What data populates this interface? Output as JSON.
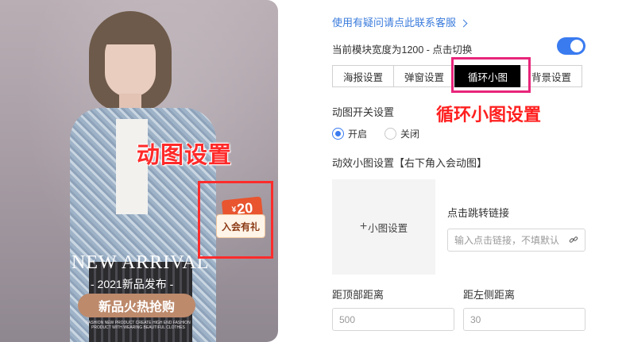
{
  "poster": {
    "gif_heading": "动图设置",
    "coupon": {
      "currency": "¥",
      "amount": "20",
      "caption": "入会有礼"
    },
    "headline": "NEW ARRIVAL",
    "subline": "- 2021新品发布 -",
    "cta": "新品火热抢购",
    "fine_print": "FASHION NEW PRODUCT CREATE HIGH END FASHION PRODUCT WITH WEARING BEAUTIFUL CLOTHES"
  },
  "panel": {
    "help_link": "使用有疑问请点此联系客服",
    "width_notice": "当前模块宽度为1200 - 点击切换",
    "toggle_on": true,
    "tabs": [
      {
        "label": "海报设置",
        "active": false
      },
      {
        "label": "弹窗设置",
        "active": false
      },
      {
        "label": "循环小图",
        "active": true
      },
      {
        "label": "背景设置",
        "active": false
      }
    ],
    "annotation": "循环小图设置",
    "gif_switch": {
      "label": "动图开关设置",
      "options": [
        "开启",
        "关闭"
      ],
      "selected": "开启"
    },
    "small_image": {
      "label": "动效小图设置【右下角入会动图】",
      "upload_label": "小图设置",
      "link_label": "点击跳转链接",
      "link_placeholder": "输入点击链接，不填默认"
    },
    "top_distance": {
      "label": "距顶部距离",
      "value": "500"
    },
    "left_distance": {
      "label": "距左侧距离",
      "value": "30"
    }
  },
  "colors": {
    "accent": "#3a7bf0",
    "annotation_red": "#ff1f1f",
    "highlight_box": "#ff2c2c",
    "tab_highlight": "#e8257a",
    "cta_brown": "#bd8a6c"
  }
}
